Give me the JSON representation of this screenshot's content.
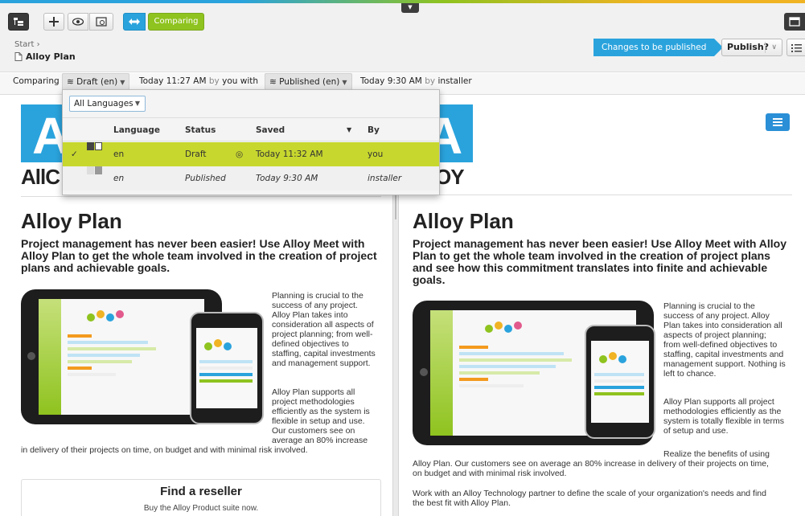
{
  "toolbar": {
    "comparing_label": "Comparing"
  },
  "breadcrumb": {
    "start": "Start",
    "page_title": "Alloy Plan"
  },
  "status": {
    "changes_banner": "Changes to be published",
    "publish_label": "Publish?"
  },
  "compare_bar": {
    "label": "Comparing",
    "left_version": "Draft (en)",
    "left_time": "Today 11:27 AM",
    "by_word": "by",
    "left_author": "you",
    "with_word": "with",
    "right_version": "Published (en)",
    "right_time": "Today 9:30 AM",
    "right_by": "by",
    "right_author": "installer"
  },
  "dropdown": {
    "language_filter": "All Languages",
    "columns": [
      "Language",
      "Status",
      "Saved",
      "By"
    ],
    "rows": [
      {
        "language": "en",
        "status": "Draft",
        "saved": "Today 11:32 AM",
        "by": "you",
        "selected": true
      },
      {
        "language": "en",
        "status": "Published",
        "saved": "Today 9:30 AM",
        "by": "installer",
        "selected": false
      }
    ]
  },
  "left": {
    "logo_letter": "A",
    "logo_word": "AllC",
    "title": "Alloy Plan",
    "lead": "Project management has never been easier! Use Alloy Meet with Alloy Plan to get the whole team involved in the creation of project plans and achievable goals.",
    "p1_lines": [
      "Planning is crucial to the",
      "success of any project.",
      "Alloy Plan takes into",
      "consideration all aspects of",
      "project planning; from well-",
      "defined objectives to",
      "staffing, capital investments",
      "and management support."
    ],
    "p2_lines": [
      "Alloy Plan supports all",
      "project methodologies",
      "efficiently as the system is",
      "flexible in setup and use.",
      "Our customers see on",
      "average an 80% increase"
    ],
    "p2_tail": "in delivery of their projects on time, on budget and with minimal risk involved.",
    "reseller_title": "Find a reseller",
    "reseller_sub": "Buy the Alloy Product suite now."
  },
  "right": {
    "logo_letter": "A",
    "logo_word": "OY",
    "title": "Alloy Plan",
    "lead": "Project management has never been easier! Use Alloy Meet with Alloy Plan to get the whole team involved in the creation of project plans and see how this commitment translates into finite and achievable goals.",
    "p1_lines": [
      "Planning is crucial to the",
      "success of any project. Alloy",
      "Plan takes into consideration all",
      "aspects of project planning;",
      "from well-defined objectives to",
      "staffing, capital investments and",
      "management support. Nothing is",
      "left to chance."
    ],
    "p2_lines": [
      "Alloy Plan supports all project",
      "methodologies efficiently as the",
      "system is totally flexible in terms",
      "of setup and use."
    ],
    "p3_head": "Realize the benefits of using",
    "p3_lines": [
      "Alloy Plan. Our customers see on average an 80% increase in delivery of their projects on time,",
      "on budget and with minimal risk involved."
    ],
    "p4_lines": [
      "Work with an Alloy Technology partner to define the scale of your organization's needs and find",
      "the best fit with Alloy Plan."
    ]
  },
  "colors": {
    "accent_blue": "#2aa3dd",
    "accent_green": "#8fc31f",
    "selected_row": "#c7d72e"
  }
}
